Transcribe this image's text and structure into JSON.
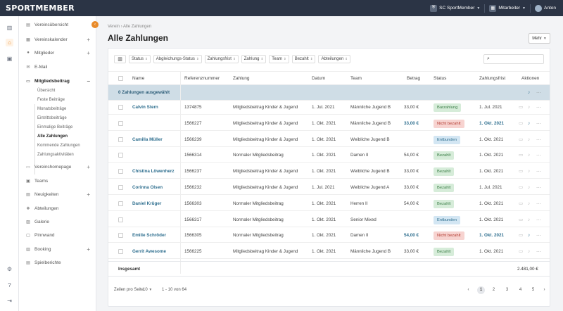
{
  "app": {
    "logo": "SPORTMEMBER",
    "club": "SC SportMember",
    "role": "Mitarbeiter",
    "user": "Anton"
  },
  "sidebar": {
    "items": [
      {
        "label": "Vereinsübersicht",
        "icon": "home-list-icon"
      },
      {
        "label": "Vereinskalender",
        "icon": "calendar-icon"
      },
      {
        "label": "Mitglieder",
        "icon": "users-icon"
      },
      {
        "label": "E-Mail",
        "icon": "mail-icon"
      },
      {
        "label": "Mitgliedsbeitrag",
        "icon": "card-icon"
      },
      {
        "label": "Vereinshomepage",
        "icon": "monitor-icon"
      },
      {
        "label": "Teams",
        "icon": "team-icon"
      },
      {
        "label": "Neuigkeiten",
        "icon": "news-icon"
      },
      {
        "label": "Abteilungen",
        "icon": "departments-icon"
      },
      {
        "label": "Galerie",
        "icon": "gallery-icon"
      },
      {
        "label": "Pinnwand",
        "icon": "board-icon"
      },
      {
        "label": "Booking",
        "icon": "booking-icon"
      },
      {
        "label": "Spielberichte",
        "icon": "report-icon"
      }
    ],
    "subitems": [
      "Übersicht",
      "Feste Beiträge",
      "Monatsbeiträge",
      "Eintrittsbeiträge",
      "Einmalige Beiträge",
      "Alle Zahlungen",
      "Kommende Zahlungen",
      "Zahlungsaktivitäten"
    ]
  },
  "page": {
    "breadcrumb_1": "Verein",
    "breadcrumb_sep": "›",
    "breadcrumb_2": "Alle Zahlungen",
    "title": "Alle Zahlungen",
    "more": "Mehr"
  },
  "filters": [
    "Status",
    "Abgleichungs-Status",
    "Zahlungsfrist",
    "Zahlung",
    "Team",
    "Bezahlt",
    "Abteilungen"
  ],
  "search": {
    "placeholder": ""
  },
  "table": {
    "headers": {
      "name": "Name",
      "ref": "Referenznummer",
      "payment": "Zahlung",
      "date": "Datum",
      "team": "Team",
      "amount": "Betrag",
      "status": "Status",
      "due": "Zahlungsfrist",
      "actions": "Aktionen"
    },
    "selection": "0 Zahlungen ausgewählt",
    "rows": [
      {
        "name": "Calvin Stern",
        "ref": "1374875",
        "payment": "Mitgliedsbeitrag Kinder & Jugend",
        "date": "1. Jul. 2021",
        "team": "Männliche Jugend B",
        "amount": "33,00 €",
        "status": "Barzahlung",
        "due": "1. Jul. 2021"
      },
      {
        "name": "",
        "ref": "1566227",
        "payment": "Mitgliedsbeitrag Kinder & Jugend",
        "date": "1. Okt. 2021",
        "team": "Männliche Jugend B",
        "amount": "33,00 €",
        "status": "Nicht bezahlt",
        "due": "1. Okt. 2021"
      },
      {
        "name": "Camilla Müller",
        "ref": "1566239",
        "payment": "Mitgliedsbeitrag Kinder & Jugend",
        "date": "1. Okt. 2021",
        "team": "Weibliche Jugend B",
        "amount": "",
        "status": "Entbunden",
        "due": "1. Okt. 2021"
      },
      {
        "name": "",
        "ref": "1566314",
        "payment": "Normaler Mitgliedsbeitrag",
        "date": "1. Okt. 2021",
        "team": "Damen II",
        "amount": "54,00 €",
        "status": "Bezahlt",
        "due": "1. Okt. 2021"
      },
      {
        "name": "Chistina Löwenherz",
        "ref": "1566237",
        "payment": "Mitgliedsbeitrag Kinder & Jugend",
        "date": "1. Okt. 2021",
        "team": "Weibliche Jugend B",
        "amount": "33,00 €",
        "status": "Bezahlt",
        "due": "1. Okt. 2021"
      },
      {
        "name": "Corinna Olsen",
        "ref": "1566232",
        "payment": "Mitgliedsbeitrag Kinder & Jugend",
        "date": "1. Jul. 2021",
        "team": "Weibliche Jugend A",
        "amount": "33,00 €",
        "status": "Bezahlt",
        "due": "1. Jul. 2021"
      },
      {
        "name": "Daniel Krüger",
        "ref": "1566303",
        "payment": "Normaler Mitgliedsbeitrag",
        "date": "1. Okt. 2021",
        "team": "Herren II",
        "amount": "54,00 €",
        "status": "Bezahlt",
        "due": "1. Okt. 2021"
      },
      {
        "name": "",
        "ref": "1566317",
        "payment": "Normaler Mitgliedsbeitrag",
        "date": "1. Okt. 2021",
        "team": "Senior Mixed",
        "amount": "",
        "status": "Entbunden",
        "due": "1. Okt. 2021"
      },
      {
        "name": "Emilie Schröder",
        "ref": "1566305",
        "payment": "Normaler Mitgliedsbeitrag",
        "date": "1. Okt. 2021",
        "team": "Damen II",
        "amount": "54,00 €",
        "status": "Nicht bezahlt",
        "due": "1. Okt. 2021"
      },
      {
        "name": "Gerrit Awesome",
        "ref": "1566225",
        "payment": "Mitgliedsbeitrag Kinder & Jugend",
        "date": "1. Okt. 2021",
        "team": "Männliche Jugend B",
        "amount": "33,00 €",
        "status": "Bezahlt",
        "due": "1. Okt. 2021"
      }
    ],
    "total_label": "Insgesamt",
    "total_value": "2.481,00 €"
  },
  "footer": {
    "per_page_label": "Zeilen pro Seite:",
    "per_page_value": "10",
    "range": "1 - 10 von 64",
    "pages": [
      "1",
      "2",
      "3",
      "4",
      "5"
    ],
    "prev": "‹",
    "next": "›"
  },
  "colors": {
    "accent": "#e98b2a",
    "topbar": "#2b3445",
    "link": "#2f6f8f",
    "selection": "#cfdde6"
  }
}
